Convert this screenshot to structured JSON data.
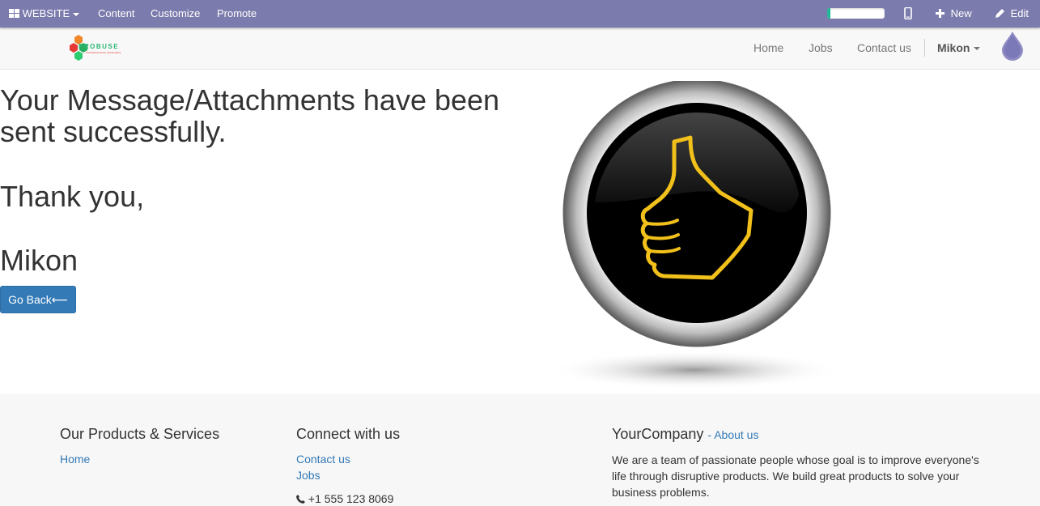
{
  "adminbar": {
    "website_label": "WEBSITE",
    "content_label": "Content",
    "customize_label": "Customize",
    "promote_label": "Promote",
    "progress": 0.05,
    "new_label": "New",
    "edit_label": "Edit"
  },
  "navbar": {
    "logo_text": "PROBUSE",
    "logo_tagline": "PROFESSIONAL BUSINESS",
    "links": [
      "Home",
      "Jobs",
      "Contact us"
    ],
    "user": "Mikon"
  },
  "main": {
    "line1": "Your Message/Attachments have been",
    "line2": "sent successfully.",
    "thanks": "Thank you,",
    "name": "Mikon",
    "go_back_label": "Go Back⟵"
  },
  "footer": {
    "products_heading": "Our Products & Services",
    "products_link": "Home",
    "connect_heading": "Connect with us",
    "connect_links": [
      "Contact us",
      "Jobs"
    ],
    "phone": "+1 555 123 8069",
    "company_heading": "YourCompany",
    "about_link": "- About us",
    "company_text": "We are a team of passionate people whose goal is to improve everyone's life through disruptive products. We build great products to solve your business problems."
  },
  "colors": {
    "adminbar_bg": "#7c7bad",
    "link": "#337ab7",
    "button": "#337ab7",
    "progress_fill": "#21b799"
  }
}
